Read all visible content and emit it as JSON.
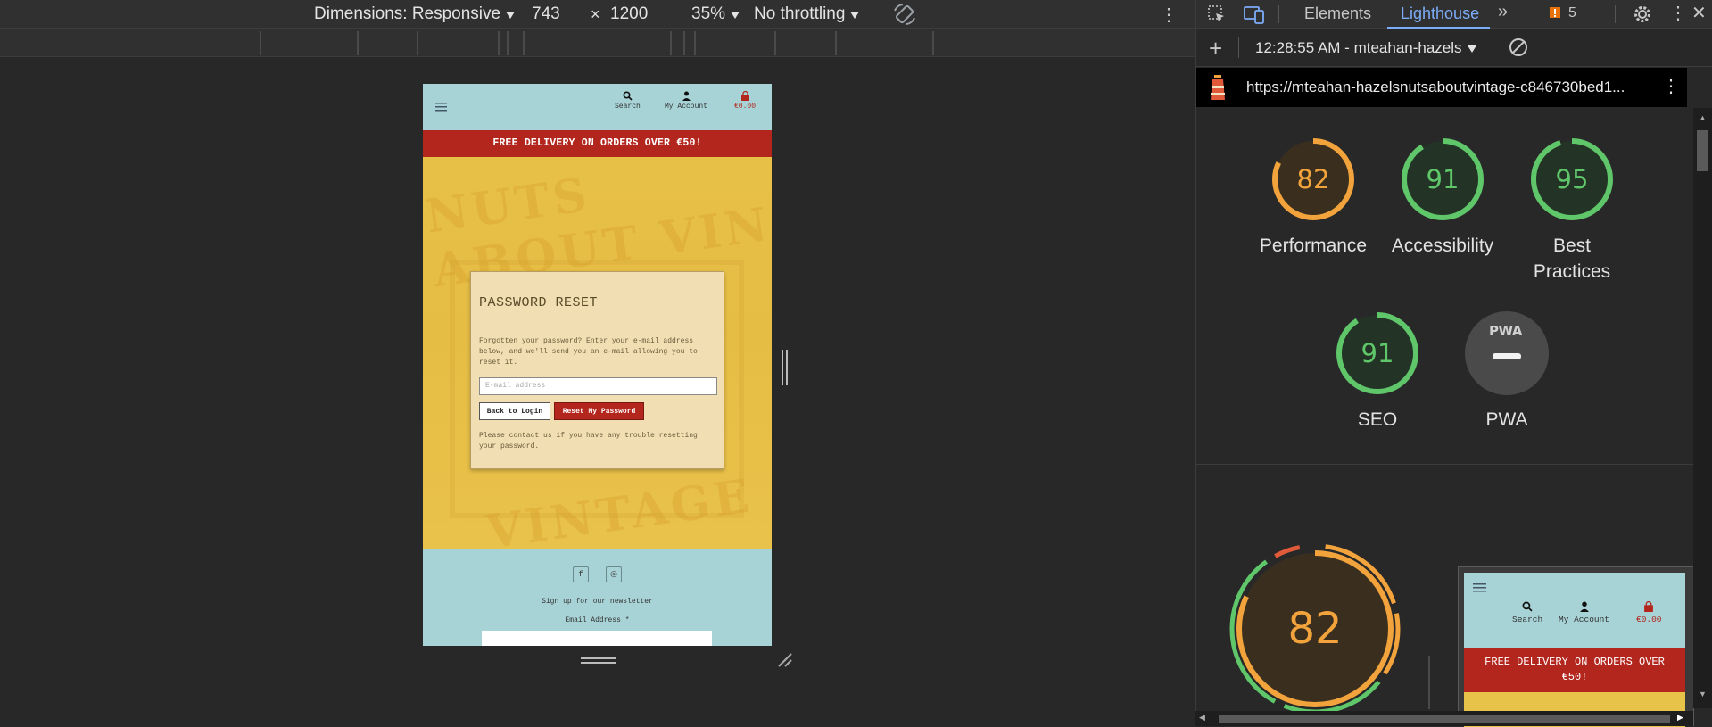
{
  "device_toolbar": {
    "dimensions_label": "Dimensions: Responsive",
    "width": "743",
    "times": "×",
    "height": "1200",
    "zoom": "35%",
    "throttling": "No throttling"
  },
  "site": {
    "header": {
      "search_label": "Search",
      "account_label": "My Account",
      "cart_total": "€0.00"
    },
    "banner": "FREE DELIVERY ON ORDERS OVER €50!",
    "hero_words": [
      "NUTS ABOUT VIN",
      "VINTAGE"
    ],
    "reset_card": {
      "title": "PASSWORD RESET",
      "description": "Forgotten your password? Enter your e-mail address below, and we'll send you an e-mail allowing you to reset it.",
      "email_placeholder": "E-mail address",
      "back_button": "Back to Login",
      "reset_button": "Reset My Password",
      "help_text": "Please contact us if you have any trouble resetting your password."
    },
    "footer": {
      "social": [
        "f",
        "◎"
      ],
      "newsletter_heading": "Sign up for our newsletter",
      "email_label": "Email Address *"
    }
  },
  "devtools": {
    "tabs": [
      "Elements",
      "Lighthouse"
    ],
    "active_tab": "Lighthouse",
    "more_tabs": "»",
    "issues_count": "5",
    "report_label": "12:28:55 AM - mteahan-hazels",
    "url": "https://mteahan-hazelsnutsaboutvintage-c846730bed1...",
    "scores": [
      {
        "name": "Performance",
        "value": "82",
        "score": 0.82,
        "color": "#f2a33c",
        "bg": "#3a2f1f"
      },
      {
        "name": "Accessibility",
        "value": "91",
        "score": 0.91,
        "color": "#5fc66a",
        "bg": "#233326"
      },
      {
        "name": "Best Practices",
        "value": "95",
        "score": 0.95,
        "color": "#5fc66a",
        "bg": "#233326"
      },
      {
        "name": "SEO",
        "value": "91",
        "score": 0.91,
        "color": "#5fc66a",
        "bg": "#233326"
      },
      {
        "name": "PWA",
        "value": "PWA",
        "score": 0,
        "color": "#e3e3e3",
        "bg": "#4a4a4a"
      }
    ],
    "big_score": {
      "value": "82",
      "score": 0.82,
      "color": "#f2a33c"
    },
    "thumbnail": {
      "search_label": "Search",
      "account_label": "My Account",
      "cart_total": "€0.00",
      "banner": "FREE DELIVERY ON ORDERS OVER €50!"
    }
  }
}
